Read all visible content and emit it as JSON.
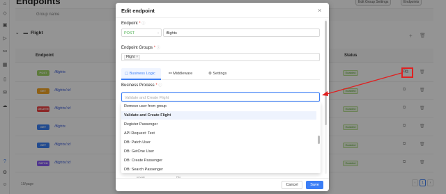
{
  "app": {
    "page_title": "Endpoints",
    "top_buttons": [
      "Edit Group Settings",
      "Endpoints"
    ],
    "group_name_header": "Group name",
    "group": "Flight",
    "columns": {
      "endpoint": "Endpoint",
      "status": "Status"
    },
    "rows": [
      {
        "method": "POST",
        "path": "/flights",
        "status": "Enabled",
        "color": "#a0d468"
      },
      {
        "method": "GET",
        "path": "/flights/:id",
        "status": "Enabled",
        "color": "#f5a623"
      },
      {
        "method": "DELETE",
        "path": "/flights/:id",
        "status": "Enabled",
        "color": "#ef4444"
      },
      {
        "method": "GET",
        "path": "/flights",
        "status": "Enabled",
        "color": "#3b82f6"
      },
      {
        "method": "GET",
        "path": "/flights/:id",
        "status": "Enabled",
        "color": "#3b82f6"
      },
      {
        "method": "PATCH",
        "path": "/flights/:id",
        "status": "Enabled",
        "color": "#8b5cf6"
      }
    ],
    "pagination": {
      "page_size": "10/page",
      "current": "1"
    }
  },
  "modal": {
    "title": "Edit endpoint",
    "endpoint_label": "Endpoint",
    "method": "POST",
    "path": "/flights",
    "groups_label": "Endpoint Groups",
    "group_tag": "Flight",
    "tabs": [
      "Business Logic",
      "Middleware",
      "Settings"
    ],
    "business_process_label": "Business Process",
    "business_process_placeholder": "Validate and Create Flight",
    "options": [
      "Remove user from group",
      "Validate and Create Flight",
      "Register Passenger",
      "API Request: Test",
      "DB: Patch User",
      "DB: GetOne User",
      "DB: Create Passenger",
      "DB: Search Passenger"
    ],
    "active_option_index": 1,
    "behind_text": [
      "private",
      "File"
    ],
    "cancel_label": "Cancel",
    "save_label": "Save"
  },
  "colors": {
    "accent": "#3b7ef6",
    "annotation": "#e02020"
  }
}
